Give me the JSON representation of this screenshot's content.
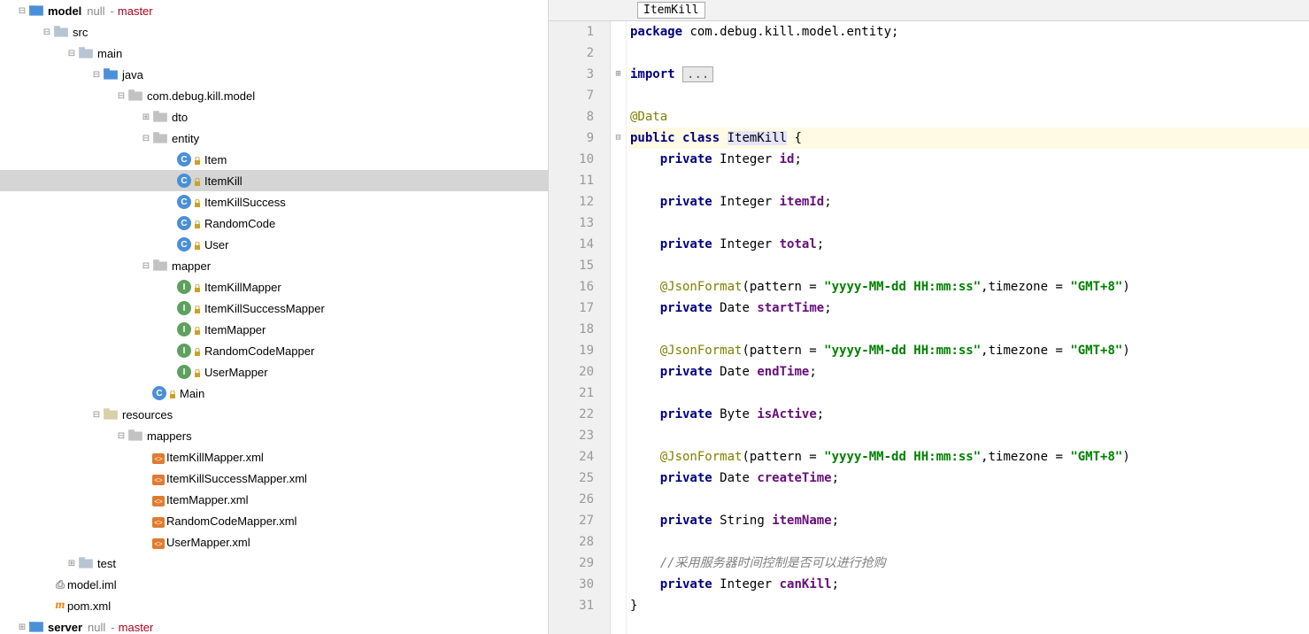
{
  "breadcrumb": {
    "class": "ItemKill"
  },
  "vcs": {
    "null": "null",
    "branch": "master"
  },
  "tree": {
    "model": "model",
    "server": "server",
    "src": "src",
    "main": "main",
    "java": "java",
    "pkg": "com.debug.kill.model",
    "dto": "dto",
    "entity": "entity",
    "cls_item": "Item",
    "cls_itemkill": "ItemKill",
    "cls_itemkillsuccess": "ItemKillSuccess",
    "cls_randomcode": "RandomCode",
    "cls_user": "User",
    "mapper": "mapper",
    "if_itemkillmapper": "ItemKillMapper",
    "if_itemkillsuccessmapper": "ItemKillSuccessMapper",
    "if_itemmapper": "ItemMapper",
    "if_randomcodemapper": "RandomCodeMapper",
    "if_usermapper": "UserMapper",
    "cls_main": "Main",
    "resources": "resources",
    "mappers": "mappers",
    "xml_itemkillmapper": "ItemKillMapper.xml",
    "xml_itemkillsuccessmapper": "ItemKillSuccessMapper.xml",
    "xml_itemmapper": "ItemMapper.xml",
    "xml_randomcodemapper": "RandomCodeMapper.xml",
    "xml_usermapper": "UserMapper.xml",
    "test": "test",
    "modeliml": "model.iml",
    "pomxml": "pom.xml"
  },
  "code": {
    "gutter": [
      "1",
      "2",
      "3",
      "7",
      "8",
      "9",
      "10",
      "11",
      "12",
      "13",
      "14",
      "15",
      "16",
      "17",
      "18",
      "19",
      "20",
      "21",
      "22",
      "23",
      "24",
      "25",
      "26",
      "27",
      "28",
      "29",
      "30",
      "31"
    ],
    "pkg_stmt_kw": "package",
    "pkg_stmt_name": " com.debug.kill.model.entity;",
    "import_kw": "import",
    "fold_ellipsis": "...",
    "ann_data": "@Data",
    "public": "public",
    "class": "class",
    "classname": "ItemKill",
    "brace_open": " {",
    "private": "private",
    "t_integer": "Integer",
    "t_date": "Date",
    "t_byte": "Byte",
    "t_string": "String",
    "f_id": "id",
    "f_itemid": "itemId",
    "f_total": "total",
    "f_starttime": "startTime",
    "f_endtime": "endTime",
    "f_isactive": "isActive",
    "f_createtime": "createTime",
    "f_itemname": "itemName",
    "f_cankill": "canKill",
    "semi": ";",
    "ann_jsonformat": "@JsonFormat",
    "jf_open": "(pattern = ",
    "jf_pattern": "\"yyyy-MM-dd HH:mm:ss\"",
    "jf_mid": ",timezone = ",
    "jf_tz": "\"GMT+8\"",
    "jf_close": ")",
    "comment_cn": "//采用服务器时间控制是否可以进行抢购",
    "brace_close": "}"
  }
}
